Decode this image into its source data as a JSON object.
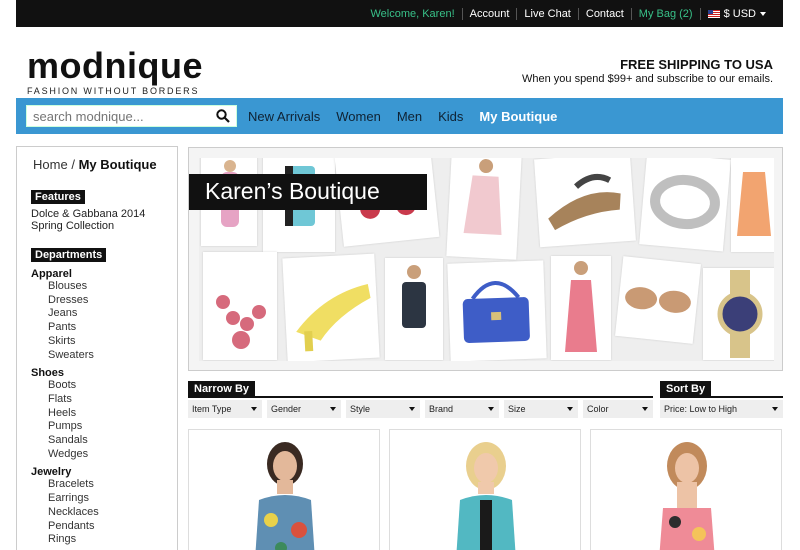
{
  "topbar": {
    "welcome": "Welcome, Karen!",
    "account": "Account",
    "live_chat": "Live Chat",
    "contact": "Contact",
    "bag": "My Bag (2)",
    "currency": "$ USD"
  },
  "header": {
    "logo": "modnique",
    "tagline": "FASHION WITHOUT BORDERS",
    "shipping_title": "FREE SHIPPING TO USA",
    "shipping_sub": "When you spend $99+ and subscribe to our emails."
  },
  "nav": {
    "search_placeholder": "search modnique...",
    "items": [
      "New Arrivals",
      "Women",
      "Men",
      "Kids",
      "My Boutique"
    ],
    "active": "My Boutique"
  },
  "sidebar": {
    "breadcrumb_home": "Home",
    "breadcrumb_sep": "/",
    "breadcrumb_current": "My Boutique",
    "features_title": "Features",
    "features_item": "Dolce & Gabbana 2014 Spring Collection",
    "departments_title": "Departments",
    "groups": [
      {
        "name": "Apparel",
        "items": [
          "Blouses",
          "Dresses",
          "Jeans",
          "Pants",
          "Skirts",
          "Sweaters"
        ]
      },
      {
        "name": "Shoes",
        "items": [
          "Boots",
          "Flats",
          "Heels",
          "Pumps",
          "Sandals",
          "Wedges"
        ]
      },
      {
        "name": "Jewelry",
        "items": [
          "Bracelets",
          "Earrings",
          "Necklaces",
          "Pendants",
          "Rings"
        ]
      }
    ]
  },
  "hero": {
    "title": "Karen’s Boutique"
  },
  "filters": {
    "narrow_label": "Narrow By",
    "sort_label": "Sort By",
    "selects": [
      "Item Type",
      "Gender",
      "Style",
      "Brand",
      "Size",
      "Color"
    ],
    "sort_value": "Price: Low to High"
  },
  "colors": {
    "nav_blue": "#3a97d2",
    "accent_green": "#38c088",
    "black": "#111111"
  }
}
